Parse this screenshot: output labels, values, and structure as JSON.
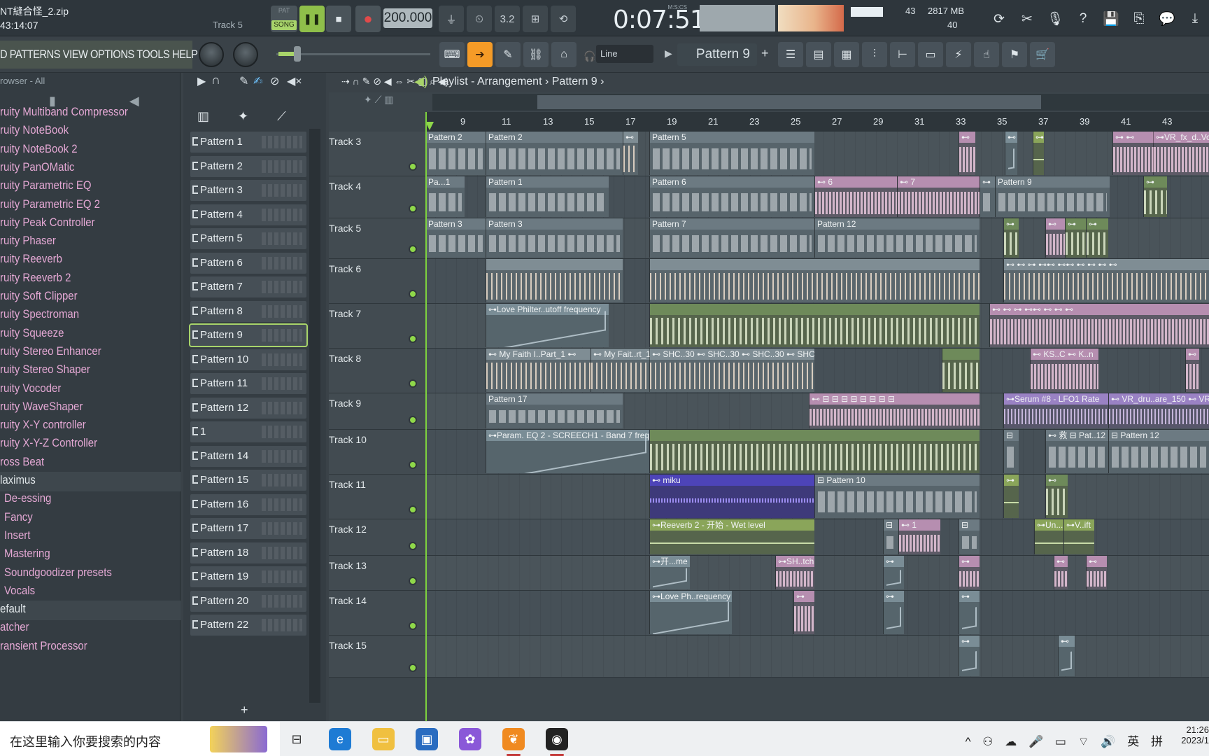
{
  "top": {
    "project_name": "NT縫合怪_2.zip",
    "time_hint": "43:14:07",
    "track_hint": "Track 5",
    "pat_label": "PAT",
    "song_label": "SONG",
    "tempo": "200.000",
    "clock_label": "M:S:CS",
    "clock_value": "0:07:51",
    "cpu_value": "43",
    "mem_value": "2817 MB",
    "poly_value": "40"
  },
  "menu": {
    "items": "D PATTERNS VIEW OPTIONS TOOLS HELP",
    "snap_value": "Line",
    "pattern_selector": "Pattern 9",
    "add_pattern": "+"
  },
  "browser": {
    "header": "rowser - All",
    "items": [
      "ruity Multiband Compressor",
      "ruity NoteBook",
      "ruity NoteBook 2",
      "ruity PanOMatic",
      "ruity Parametric EQ",
      "ruity Parametric EQ 2",
      "ruity Peak Controller",
      "ruity Phaser",
      "ruity Reeverb",
      "ruity Reeverb 2",
      "ruity Soft Clipper",
      "ruity Spectroman",
      "ruity Squeeze",
      "ruity Stereo Enhancer",
      "ruity Stereo Shaper",
      "ruity Vocoder",
      "ruity WaveShaper",
      "ruity X-Y controller",
      "ruity X-Y-Z Controller",
      "ross Beat"
    ],
    "folder": "laximus",
    "sub_items": [
      "De-essing",
      "Fancy",
      "Insert",
      "Mastering",
      "Soundgoodizer presets",
      "Vocals"
    ],
    "bottom_items": [
      "efault",
      "atcher",
      "ransient Processor"
    ]
  },
  "patterns": {
    "items": [
      "Pattern 1",
      "Pattern 2",
      "Pattern 3",
      "Pattern 4",
      "Pattern 5",
      "Pattern 6",
      "Pattern 7",
      "Pattern 8",
      "Pattern 9",
      "Pattern 10",
      "Pattern 11",
      "Pattern 12",
      "1",
      "Pattern 14",
      "Pattern 15",
      "Pattern 16",
      "Pattern 17",
      "Pattern 18",
      "Pattern 19",
      "Pattern 20",
      "Pattern 22"
    ],
    "selected": "Pattern 9",
    "add_label": "+"
  },
  "playlist": {
    "title": "Playlist - Arrangement",
    "breadcrumb_sep": "›",
    "pattern": "Pattern 9",
    "bars": [
      "9",
      "11",
      "13",
      "15",
      "17",
      "19",
      "21",
      "23",
      "25",
      "27",
      "29",
      "31",
      "33",
      "35",
      "37",
      "39",
      "41",
      "43"
    ],
    "tracks": [
      {
        "name": "Track 3",
        "clips": [
          {
            "t": "c-pat",
            "l": 0,
            "w": 86,
            "label": "Pattern 2"
          },
          {
            "t": "c-pat",
            "l": 86,
            "w": 196,
            "label": "Pattern 2"
          },
          {
            "t": "c-sample",
            "l": 282,
            "w": 22,
            "label": "⊷"
          },
          {
            "t": "c-pat",
            "l": 320,
            "w": 236,
            "label": "Pattern 5"
          },
          {
            "t": "c-pink",
            "l": 762,
            "w": 24,
            "label": "⊷"
          },
          {
            "t": "c-auto",
            "l": 828,
            "w": 18,
            "label": "⊷"
          },
          {
            "t": "c-green2",
            "l": 868,
            "w": 16,
            "label": "⊶"
          },
          {
            "t": "c-pink",
            "l": 982,
            "w": 64,
            "label": "⊶ ⊷"
          },
          {
            "t": "c-pink",
            "l": 1040,
            "w": 80,
            "label": "⊶VR_fx_d..Vo"
          }
        ]
      },
      {
        "name": "Track 4",
        "clips": [
          {
            "t": "c-pat",
            "l": 0,
            "w": 56,
            "label": "Pa...1"
          },
          {
            "t": "c-pat",
            "l": 86,
            "w": 176,
            "label": "Pattern 1"
          },
          {
            "t": "c-pat",
            "l": 320,
            "w": 236,
            "label": "Pattern 6"
          },
          {
            "t": "c-pink",
            "l": 556,
            "w": 118,
            "label": "⊷ 6"
          },
          {
            "t": "c-pink",
            "l": 674,
            "w": 118,
            "label": "⊷ 7"
          },
          {
            "t": "c-pat",
            "l": 792,
            "w": 22,
            "label": "⊶"
          },
          {
            "t": "c-pat",
            "l": 814,
            "w": 164,
            "label": "Pattern 9"
          },
          {
            "t": "c-green",
            "l": 1026,
            "w": 34,
            "label": "⊶"
          }
        ]
      },
      {
        "name": "Track 5",
        "clips": [
          {
            "t": "c-pat",
            "l": 0,
            "w": 86,
            "label": "Pattern 3"
          },
          {
            "t": "c-pat",
            "l": 86,
            "w": 196,
            "label": "Pattern 3"
          },
          {
            "t": "c-pat",
            "l": 320,
            "w": 236,
            "label": "Pattern 7"
          },
          {
            "t": "c-pat",
            "l": 556,
            "w": 236,
            "label": "Pattern 12"
          },
          {
            "t": "c-green",
            "l": 826,
            "w": 22,
            "label": "⊶"
          },
          {
            "t": "c-pink",
            "l": 886,
            "w": 28,
            "label": "⊷"
          },
          {
            "t": "c-green",
            "l": 914,
            "w": 30,
            "label": "⊶"
          },
          {
            "t": "c-green",
            "l": 944,
            "w": 32,
            "label": "⊶"
          }
        ]
      },
      {
        "name": "Track 6",
        "clips": [
          {
            "t": "c-sample",
            "l": 86,
            "w": 196,
            "label": ""
          },
          {
            "t": "c-sample",
            "l": 320,
            "w": 472,
            "label": ""
          },
          {
            "t": "c-sample",
            "l": 826,
            "w": 294,
            "label": "⊷ ⊷ ⊶ ⊷⊷ ⊷⊷ ⊷ ⊷ ⊷ ⊷"
          }
        ]
      },
      {
        "name": "Track 7",
        "clips": [
          {
            "t": "c-auto",
            "l": 86,
            "w": 176,
            "label": "⊶Love Philter..utoff frequency"
          },
          {
            "t": "c-green",
            "l": 320,
            "w": 472,
            "label": ""
          },
          {
            "t": "c-pink",
            "l": 806,
            "w": 314,
            "label": "⊷  ⊷ ⊶ ⊷⊷ ⊷ ⊷ ⊷"
          }
        ]
      },
      {
        "name": "Track 8",
        "clips": [
          {
            "t": "c-sample",
            "l": 86,
            "w": 150,
            "label": "⊷ My Faith I..Part_1 ⊷"
          },
          {
            "t": "c-sample",
            "l": 236,
            "w": 86,
            "label": "⊷ My Fait..rt_1"
          },
          {
            "t": "c-sample",
            "l": 320,
            "w": 236,
            "label": "⊷ SHC..30 ⊷ SHC..30 ⊷ SHC..30 ⊷ SHC..30"
          },
          {
            "t": "c-green",
            "l": 738,
            "w": 54,
            "label": ""
          },
          {
            "t": "c-pink",
            "l": 864,
            "w": 98,
            "label": "⊷ KS..C ⊷ K..n"
          },
          {
            "t": "c-pink",
            "l": 1086,
            "w": 20,
            "label": "⊷"
          }
        ]
      },
      {
        "name": "Track 9",
        "clips": [
          {
            "t": "c-pat",
            "l": 86,
            "w": 196,
            "label": "Pattern 17"
          },
          {
            "t": "c-pink",
            "l": 548,
            "w": 244,
            "label": "⊷ ⊟ ⊟ ⊟ ⊟ ⊟ ⊟ ⊟ ⊟"
          },
          {
            "t": "c-lilac",
            "l": 826,
            "w": 150,
            "label": "⊶Serum #8 - LFO1 Rate"
          },
          {
            "t": "c-lilac",
            "l": 976,
            "w": 144,
            "label": "⊷ VR_dru..are_150 ⊷ VR"
          }
        ]
      },
      {
        "name": "Track 10",
        "clips": [
          {
            "t": "c-auto",
            "l": 86,
            "w": 234,
            "label": "⊶Param. EQ 2 - SCREECH1 - Band 7 freq"
          },
          {
            "t": "c-green",
            "l": 320,
            "w": 472,
            "label": ""
          },
          {
            "t": "c-pat",
            "l": 826,
            "w": 22,
            "label": "⊟"
          },
          {
            "t": "c-pat",
            "l": 886,
            "w": 90,
            "label": "⊷ 救 ⊟ Pat..12"
          },
          {
            "t": "c-pat",
            "l": 976,
            "w": 144,
            "label": "⊟ Pattern 12"
          }
        ]
      },
      {
        "name": "Track 11",
        "clips": [
          {
            "t": "c-blue",
            "l": 320,
            "w": 236,
            "label": "⊷ miku"
          },
          {
            "t": "c-pat",
            "l": 556,
            "w": 236,
            "label": "⊟ Pattern 10"
          },
          {
            "t": "c-green2",
            "l": 826,
            "w": 22,
            "label": "⊶"
          },
          {
            "t": "c-green",
            "l": 886,
            "w": 32,
            "label": "⊷"
          }
        ]
      },
      {
        "name": "Track 12",
        "clips": [
          {
            "t": "c-green2",
            "l": 320,
            "w": 236,
            "label": "⊶Reeverb 2 - 开始 - Wet level"
          },
          {
            "t": "c-pat",
            "l": 654,
            "w": 22,
            "label": "⊟"
          },
          {
            "t": "c-pink",
            "l": 676,
            "w": 60,
            "label": "⊷ 1"
          },
          {
            "t": "c-pat",
            "l": 762,
            "w": 30,
            "label": "⊟"
          },
          {
            "t": "c-green2",
            "l": 870,
            "w": 42,
            "label": "⊶Un..."
          },
          {
            "t": "c-green2",
            "l": 912,
            "w": 44,
            "label": "⊶V..ift"
          }
        ]
      },
      {
        "name": "Track 13",
        "clips": [
          {
            "t": "c-auto",
            "l": 320,
            "w": 58,
            "label": "⊶开...me"
          },
          {
            "t": "c-pink",
            "l": 500,
            "w": 56,
            "label": "⊶SH..tch"
          },
          {
            "t": "c-auto",
            "l": 654,
            "w": 30,
            "label": "⊶"
          },
          {
            "t": "c-pink",
            "l": 762,
            "w": 30,
            "label": "⊶"
          },
          {
            "t": "c-pink",
            "l": 898,
            "w": 20,
            "label": "⊷"
          },
          {
            "t": "c-pink",
            "l": 944,
            "w": 30,
            "label": "⊷"
          }
        ]
      },
      {
        "name": "Track 14",
        "clips": [
          {
            "t": "c-auto",
            "l": 320,
            "w": 118,
            "label": "⊶Love Ph..requency"
          },
          {
            "t": "c-pink",
            "l": 526,
            "w": 30,
            "label": "⊶"
          },
          {
            "t": "c-auto",
            "l": 654,
            "w": 30,
            "label": "⊶"
          },
          {
            "t": "c-auto",
            "l": 762,
            "w": 30,
            "label": "⊶"
          }
        ]
      },
      {
        "name": "Track 15",
        "clips": [
          {
            "t": "c-auto",
            "l": 762,
            "w": 30,
            "label": "⊶"
          },
          {
            "t": "c-auto",
            "l": 904,
            "w": 24,
            "label": "⊷"
          }
        ]
      }
    ]
  },
  "taskbar": {
    "search_placeholder": "在这里输入你要搜索的内容",
    "tray_text": "^ ⚇ ☁ 🎤 ▭ ⌔ 🔊 英 拼",
    "time": "21:26",
    "date": "2023/1"
  },
  "colors": {
    "accent_green": "#a8d46a",
    "record_red": "#e04a4a",
    "selected_tool_orange": "#f59b27",
    "browser_plugin_pink": "#e4a8d4"
  }
}
